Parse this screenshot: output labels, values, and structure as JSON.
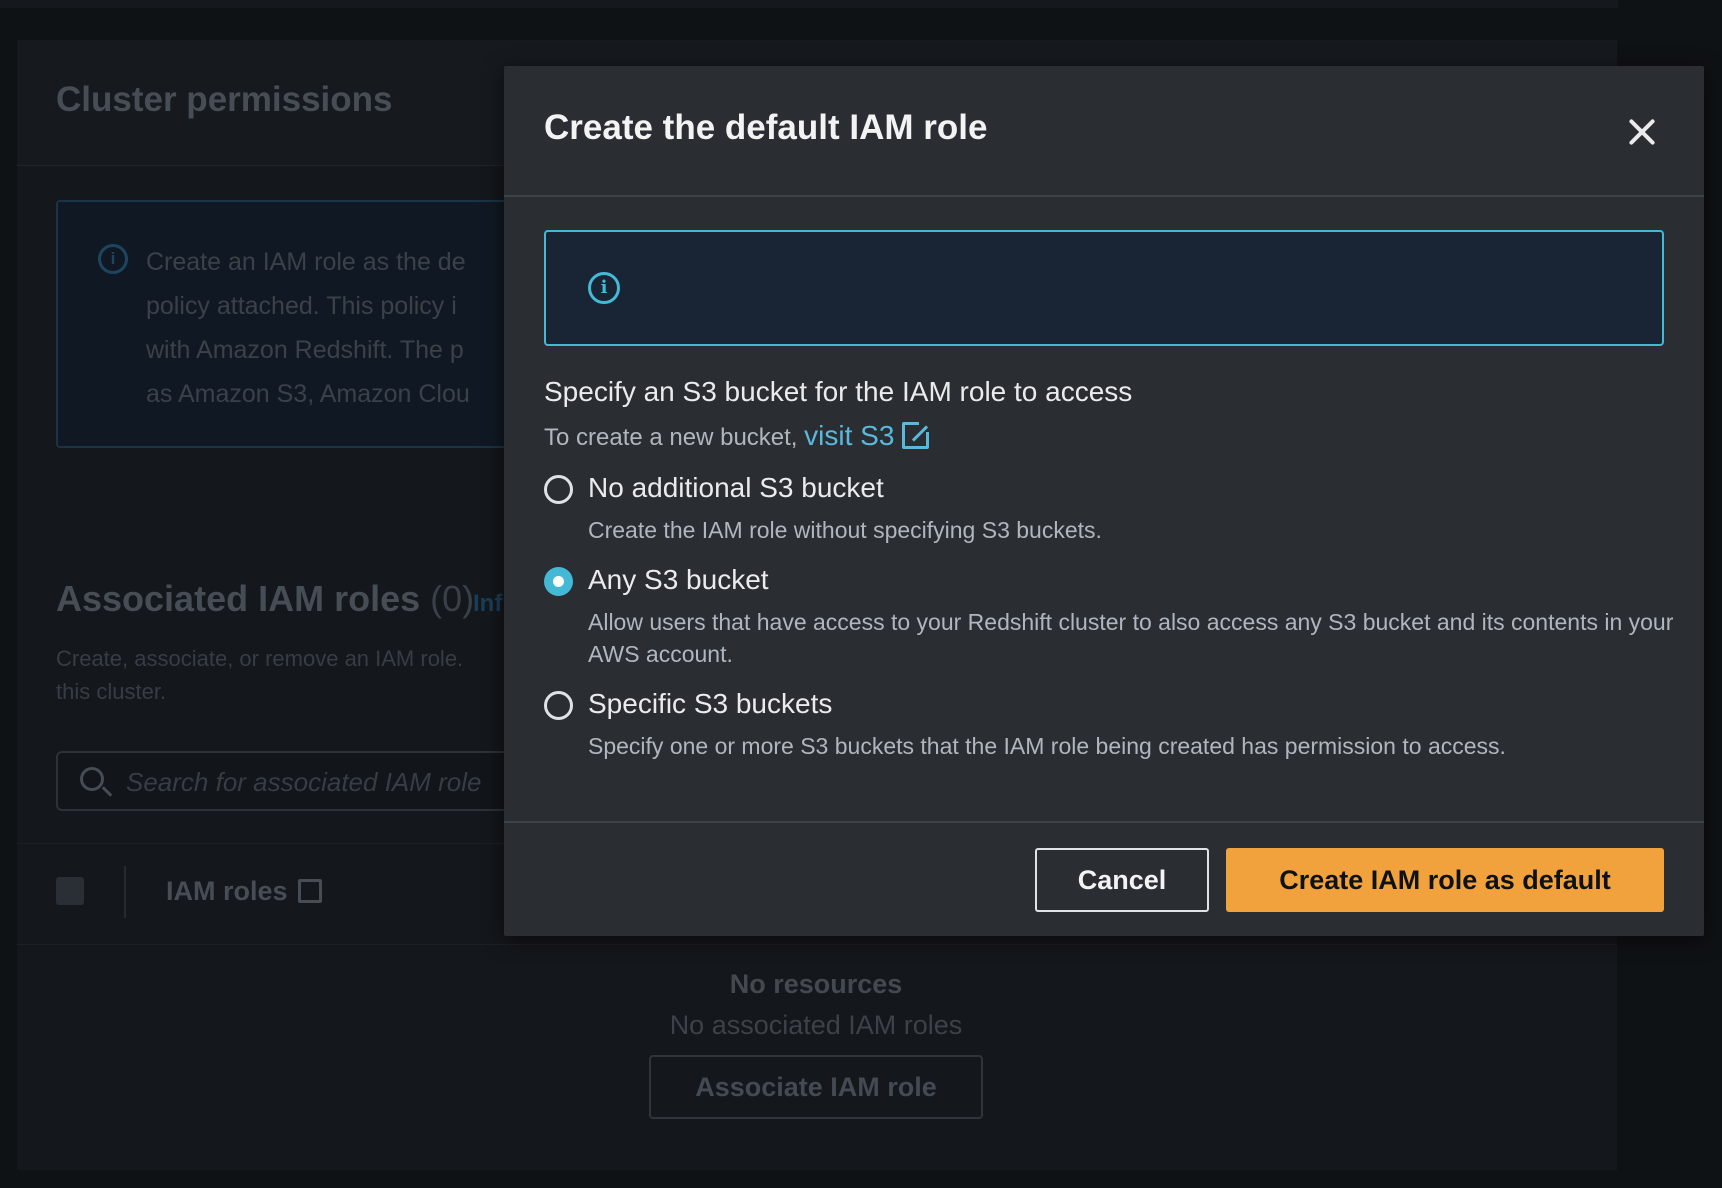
{
  "background": {
    "section_title": "Cluster permissions",
    "info_lines": [
      "Create an IAM role as the de",
      "policy attached. This policy i",
      "with Amazon Redshift. The p",
      "as Amazon S3, Amazon Clou"
    ],
    "roles_title": "Associated IAM roles",
    "roles_count": "(0)",
    "roles_info_link": "Inf",
    "roles_desc_line1": "Create, associate, or remove an IAM role.",
    "roles_desc_line2": "this cluster.",
    "search_placeholder": "Search for associated IAM role",
    "table_column": "IAM roles",
    "no_resources_title": "No resources",
    "no_resources_sub": "No associated IAM roles",
    "associate_button": "Associate IAM role"
  },
  "modal": {
    "title": "Create the default IAM role",
    "field_label": "Specify an S3 bucket for the IAM role to access",
    "field_desc_prefix": "To create a new bucket,",
    "visit_link": "visit S3",
    "options": [
      {
        "label": "No additional S3 bucket",
        "desc": "Create the IAM role without specifying S3 buckets.",
        "checked": false
      },
      {
        "label": "Any S3 bucket",
        "desc": "Allow users that have access to your Redshift cluster to also access any S3 bucket and its contents in your AWS account.",
        "checked": true
      },
      {
        "label": "Specific S3 buckets",
        "desc": "Specify one or more S3 buckets that the IAM role being created has permission to access.",
        "checked": false
      }
    ],
    "cancel_button": "Cancel",
    "primary_button": "Create IAM role as default"
  },
  "colors": {
    "accent": "#44b9d6",
    "primary_button": "#f2a23c",
    "link": "#5ab8dc",
    "modal_bg": "#2a2e33"
  },
  "icons": [
    "info-icon",
    "close-icon",
    "external-link-icon",
    "search-icon"
  ]
}
